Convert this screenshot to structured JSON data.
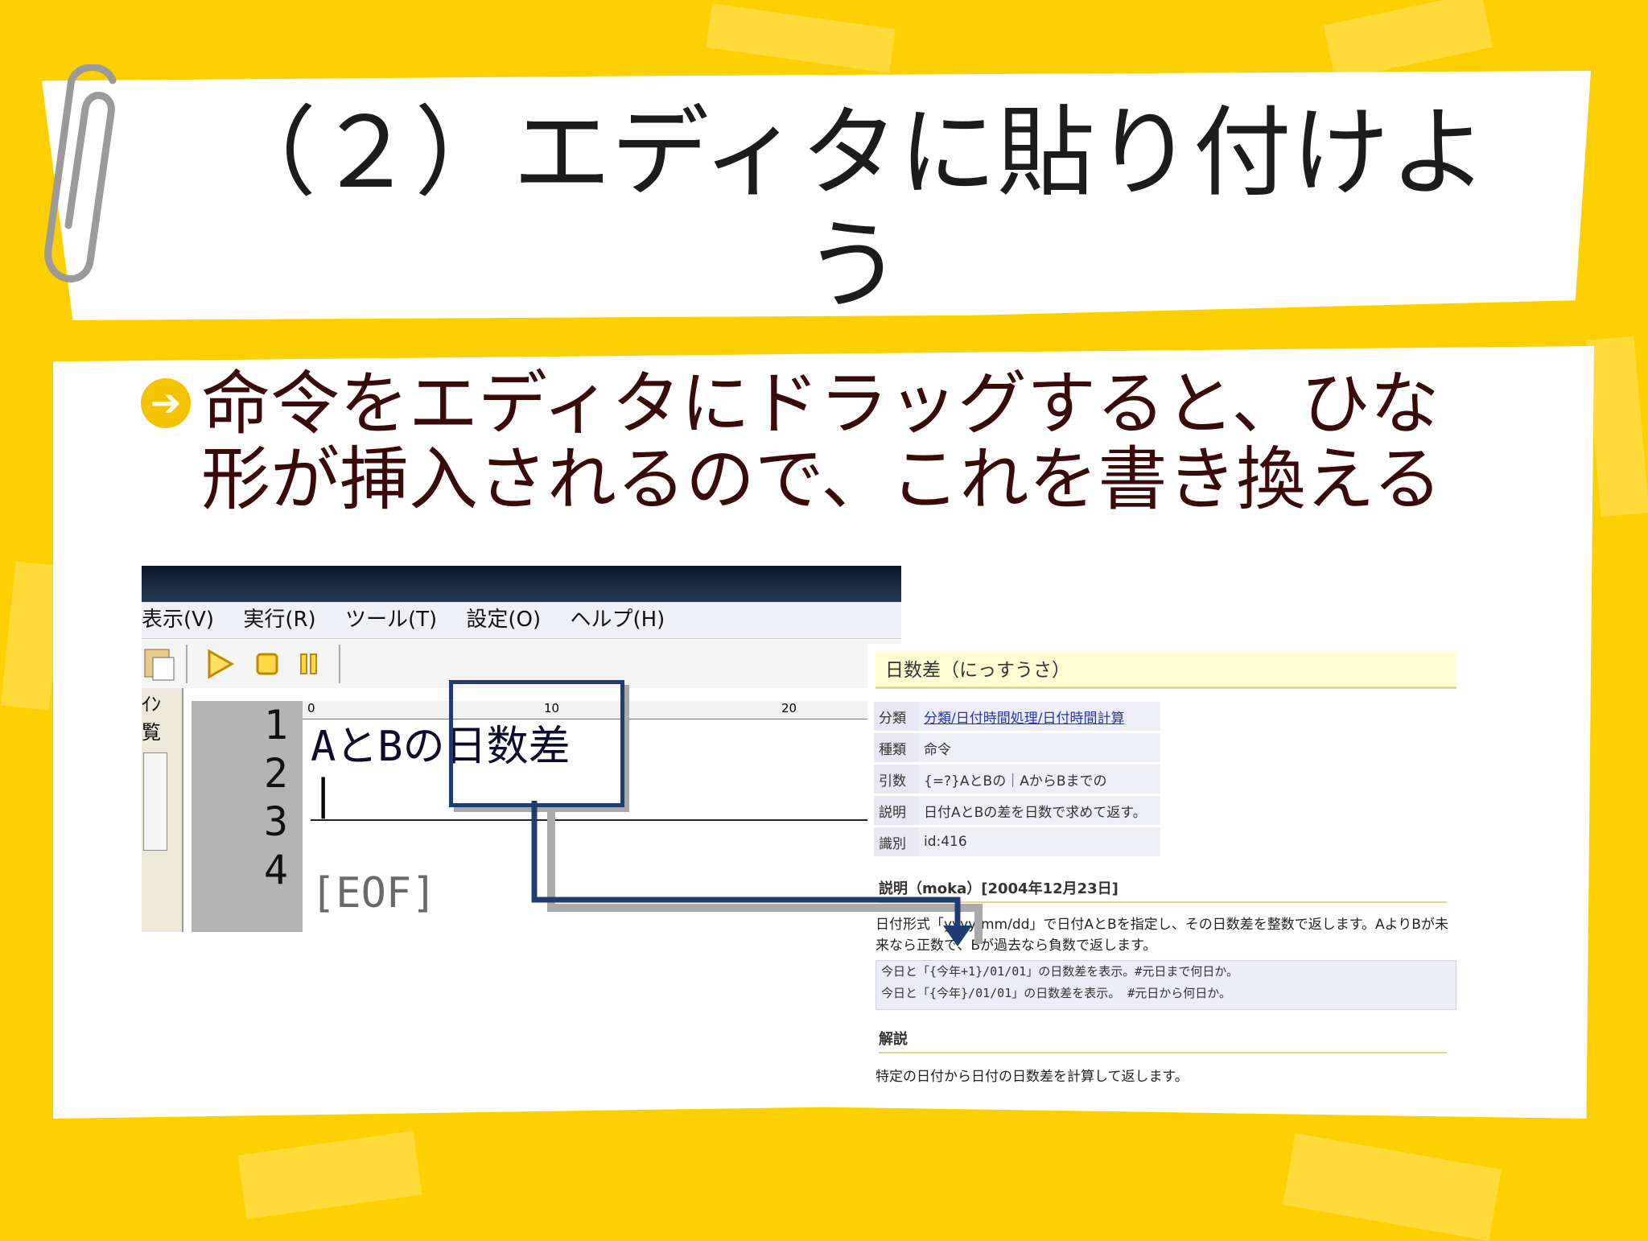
{
  "slide": {
    "title": "（２）エディタに貼り付けよう",
    "body": "命令をエディタにドラッグすると、ひな形が挿入されるので、これを書き換える",
    "bullet_icon": "arrow-right-circle-icon"
  },
  "editor": {
    "menu": [
      "表示(V)",
      "実行(R)",
      "ツール(T)",
      "設定(O)",
      "ヘルプ(H)"
    ],
    "side_labels": [
      "ｲﾝ",
      "覧"
    ],
    "ruler": [
      "0",
      "10",
      "20"
    ],
    "line_numbers": [
      "1",
      "2",
      "3",
      "4"
    ],
    "line1_a": "AとBの",
    "line1_b": "日数差",
    "eof": "[EOF]"
  },
  "doc": {
    "heading": "日数差（にっすうさ）",
    "meta": [
      {
        "key": "分類",
        "value": "分類/日付時間処理/日付時間計算"
      },
      {
        "key": "種類",
        "value": "命令"
      },
      {
        "key": "引数",
        "value": "{=?}AとBの｜AからBまでの"
      },
      {
        "key": "説明",
        "value": "日付AとBの差を日数で求めて返す。"
      },
      {
        "key": "識別",
        "value": "id:416"
      }
    ],
    "desc_heading": "説明（moka）[2004年12月23日]",
    "desc_text": "日付形式「yyyy/mm/dd」で日付AとBを指定し、その日数差を整数で返します。AよりBが未来なら正数で、Bが過去なら負数で返します。",
    "examples": [
      "今日と「{今年+1}/01/01」の日数差を表示。#元日まで何日か。",
      "今日と「{今年}/01/01」の日数差を表示。 #元日から何日か。"
    ],
    "kaisetsu_heading": "解説",
    "kaisetsu_text": "特定の日付から日付の日数差を計算して返します。"
  },
  "colors": {
    "background": "#fcd000",
    "title_text": "#1c1c1c",
    "body_text": "#3a0a0a",
    "highlight_box": "#1f3d73"
  }
}
